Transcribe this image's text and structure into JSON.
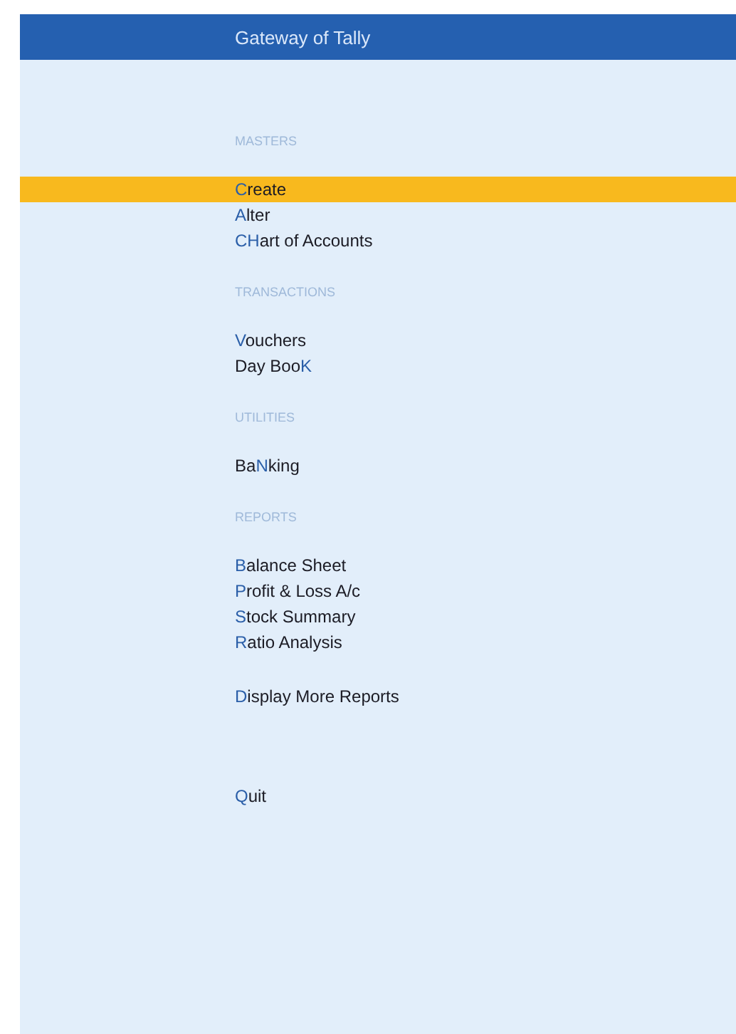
{
  "title": "Gateway of Tally",
  "sections": [
    {
      "heading": "MASTERS",
      "items": [
        {
          "key": "C",
          "after": "reate",
          "selected": true
        },
        {
          "key": "A",
          "after": "lter",
          "selected": false
        },
        {
          "key": "CH",
          "after": "art of Accounts",
          "selected": false
        }
      ]
    },
    {
      "heading": "TRANSACTIONS",
      "items": [
        {
          "key": "V",
          "after": "ouchers",
          "selected": false
        },
        {
          "before": "Day Boo",
          "key": "K",
          "selected": false
        }
      ]
    },
    {
      "heading": "UTILITIES",
      "items": [
        {
          "before": "Ba",
          "key": "N",
          "after": "king",
          "selected": false
        }
      ]
    },
    {
      "heading": "REPORTS",
      "items": [
        {
          "key": "B",
          "after": "alance Sheet",
          "selected": false
        },
        {
          "key": "P",
          "after": "rofit & Loss A/c",
          "selected": false
        },
        {
          "key": "S",
          "after": "tock Summary",
          "selected": false
        },
        {
          "key": "R",
          "after": "atio Analysis",
          "selected": false
        }
      ]
    },
    {
      "items": [
        {
          "key": "D",
          "after": "isplay More Reports",
          "selected": false
        }
      ]
    },
    {
      "kind": "exit",
      "items": [
        {
          "key": "Q",
          "after": "uit",
          "selected": false
        }
      ]
    }
  ]
}
